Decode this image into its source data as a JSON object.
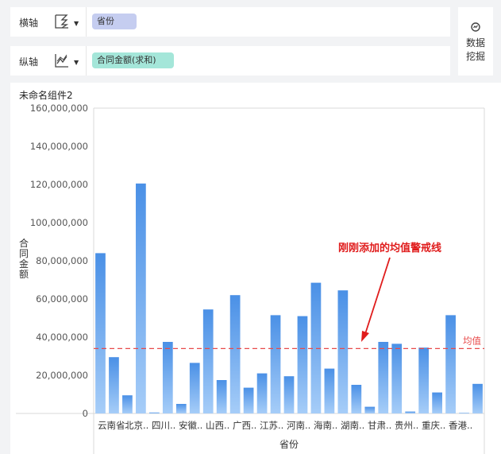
{
  "x_axis": {
    "label": "横轴",
    "field": "省份",
    "icon": "step-chart-icon"
  },
  "y_axis": {
    "label": "纵轴",
    "field": "合同金额(求和)",
    "icon": "line-chart-icon"
  },
  "data_mining": {
    "label_line1": "数据",
    "label_line2": "挖掘",
    "icon": "data-mining-icon"
  },
  "component": {
    "title": "未命名组件2"
  },
  "chart_data": {
    "type": "bar",
    "xlabel": "省份",
    "ylabel": "合同金额",
    "ylim": [
      0,
      160000000
    ],
    "yticks": [
      "0",
      "20,000,000",
      "40,000,000",
      "60,000,000",
      "80,000,000",
      "100,000,000",
      "120,000,000",
      "140,000,000",
      "160,000,000"
    ],
    "categories": [
      "云南省",
      "北京..",
      "四川..",
      "安徽..",
      "山西..",
      "广西..",
      "江苏..",
      "河南..",
      "海南..",
      "湖南..",
      "甘肃..",
      "贵州..",
      "重庆..",
      "香港.."
    ],
    "values": [
      84000000,
      29500000,
      9500000,
      120500000,
      500000,
      37500000,
      5000000,
      26500000,
      54500000,
      17500000,
      62000000,
      13500000,
      21000000,
      51500000,
      19500000,
      51000000,
      68500000,
      23500000,
      64500000,
      15000000,
      3500000,
      37500000,
      36500000,
      1000000,
      34500000,
      11000000,
      51500000,
      300000,
      15500000
    ],
    "reference_line": {
      "label": "均值",
      "value": 34000000
    },
    "annotation": "刚刚添加的均值警戒线",
    "colors": {
      "bar_top": "#4a90e6",
      "bar_bottom": "#a6cdf8",
      "ref_line": "#e84a4a",
      "annotation": "#e01c1c"
    }
  }
}
